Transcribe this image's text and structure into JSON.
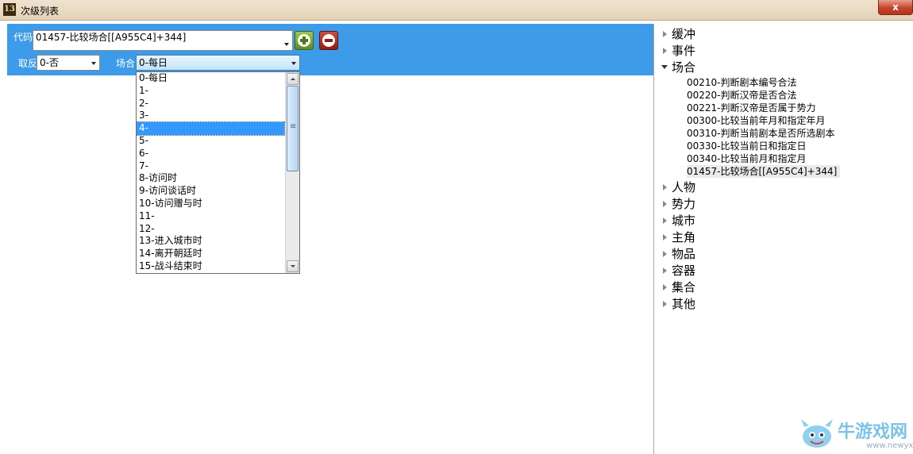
{
  "window": {
    "icon_text": "13",
    "title": "次级列表",
    "close_label": "x"
  },
  "toolbar": {
    "code_label": "代码",
    "code_value": "01457-比较场合[[A955C4]+344]",
    "negate_label": "取反",
    "negate_value": "0-否",
    "occasion_label": "场合",
    "occasion_value": "0-每日"
  },
  "dropdown": {
    "items": [
      "0-每日",
      "1-",
      "2-",
      "3-",
      "4-",
      "5-",
      "6-",
      "7-",
      "8-访问时",
      "9-访问谈话时",
      "10-访问赠与时",
      "11-",
      "12-",
      "13-进入城市时",
      "14-离开朝廷时",
      "15-战斗结束时"
    ],
    "selected_index": 4
  },
  "tree": {
    "nodes": [
      {
        "label": "缓冲",
        "expanded": false
      },
      {
        "label": "事件",
        "expanded": false
      },
      {
        "label": "场合",
        "expanded": true,
        "children": [
          "00210-判断剧本编号合法",
          "00220-判断汉帝是否合法",
          "00221-判断汉帝是否属于势力",
          "00300-比较当前年月和指定年月",
          "00310-判断当前剧本是否所选剧本",
          "00330-比较当前日和指定日",
          "00340-比较当前月和指定月",
          "01457-比较场合[[A955C4]+344]"
        ]
      },
      {
        "label": "人物",
        "expanded": false
      },
      {
        "label": "势力",
        "expanded": false
      },
      {
        "label": "城市",
        "expanded": false
      },
      {
        "label": "主角",
        "expanded": false
      },
      {
        "label": "物品",
        "expanded": false
      },
      {
        "label": "容器",
        "expanded": false
      },
      {
        "label": "集合",
        "expanded": false
      },
      {
        "label": "其他",
        "expanded": false
      }
    ]
  },
  "watermark": {
    "text": "牛游戏网",
    "url": "www.newyx.net"
  }
}
